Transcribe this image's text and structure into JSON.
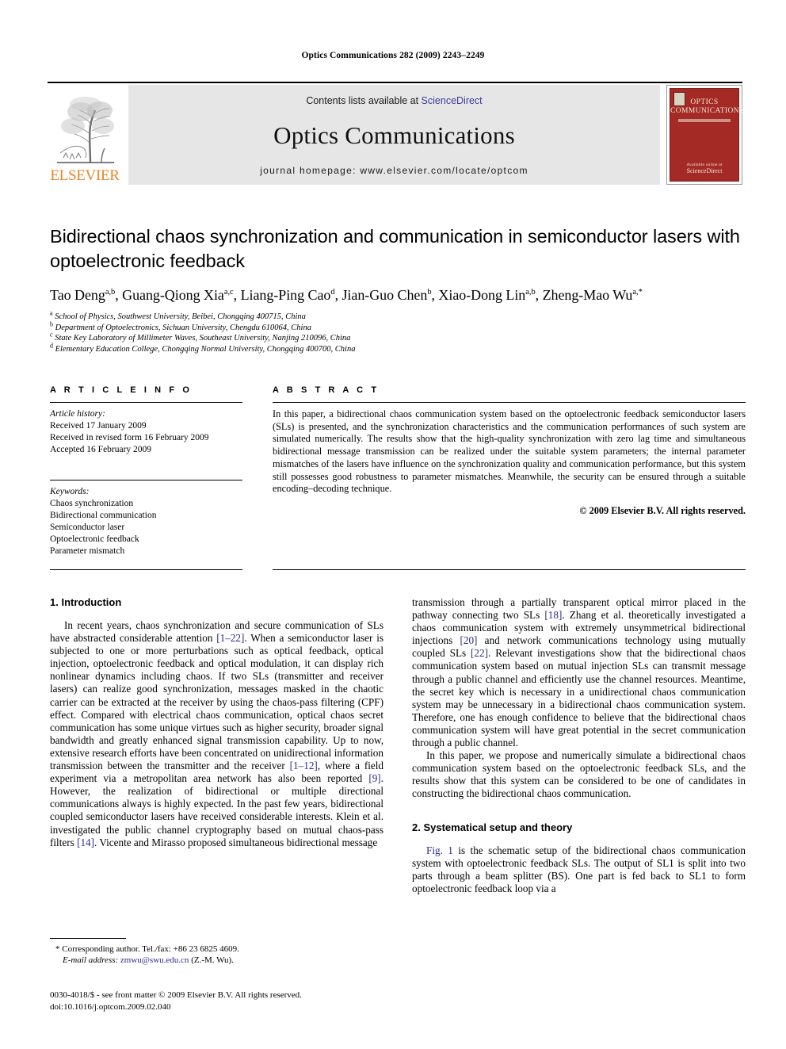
{
  "running_head": "Optics Communications 282 (2009) 2243–2249",
  "masthead": {
    "contents_prefix": "Contents lists available at ",
    "sciencedirect": "ScienceDirect",
    "journal_title": "Optics Communications",
    "homepage": "journal homepage: www.elsevier.com/locate/optcom",
    "publisher_wordmark": "ELSEVIER",
    "cover_title_line1": "OPTICS",
    "cover_title_line2": "COMMUNICATIONS",
    "cover_footer_line1": "Available online at",
    "cover_footer_line2": "ScienceDirect",
    "accent_orange": "#ec8424",
    "cover_red": "#a32a25",
    "link_blue": "#3b3b9e"
  },
  "title": "Bidirectional chaos synchronization and communication in semiconductor lasers with optoelectronic feedback",
  "authors": [
    {
      "name": "Tao Deng",
      "sup": "a,b",
      "sep": ", "
    },
    {
      "name": "Guang-Qiong Xia",
      "sup": "a,c",
      "sep": ", "
    },
    {
      "name": "Liang-Ping Cao",
      "sup": "d",
      "sep": ", "
    },
    {
      "name": "Jian-Guo Chen",
      "sup": "b",
      "sep": ", "
    },
    {
      "name": "Xiao-Dong Lin",
      "sup": "a,b",
      "sep": ", "
    },
    {
      "name": "Zheng-Mao Wu",
      "sup": "a,*",
      "sep": ""
    }
  ],
  "affiliations": [
    {
      "marker": "a",
      "text": "School of Physics, Southwest University, Beibei, Chongqing 400715, China"
    },
    {
      "marker": "b",
      "text": "Department of Optoelectronics, Sichuan University, Chengdu 610064, China"
    },
    {
      "marker": "c",
      "text": "State Key Laboratory of Millimeter Waves, Southeast University, Nanjing 210096, China"
    },
    {
      "marker": "d",
      "text": "Elementary Education College, Chongqing Normal University, Chongqing 400700, China"
    }
  ],
  "article_info": {
    "kicker": "A R T I C L E   I N F O",
    "history_label": "Article history:",
    "history": [
      "Received 17 January 2009",
      "Received in revised form 16 February 2009",
      "Accepted 16 February 2009"
    ],
    "keywords_label": "Keywords:",
    "keywords": [
      "Chaos synchronization",
      "Bidirectional communication",
      "Semiconductor laser",
      "Optoelectronic feedback",
      "Parameter mismatch"
    ]
  },
  "abstract": {
    "kicker": "A B S T R A C T",
    "text": "In this paper, a bidirectional chaos communication system based on the optoelectronic feedback semiconductor lasers (SLs) is presented, and the synchronization characteristics and the communication performances of such system are simulated numerically. The results show that the high-quality synchronization with zero lag time and simultaneous bidirectional message transmission can be realized under the suitable system parameters; the internal parameter mismatches of the lasers have influence on the synchronization quality and communication performance, but this system still possesses good robustness to parameter mismatches. Meanwhile, the security can be ensured through a suitable encoding–decoding technique.",
    "copyright": "© 2009 Elsevier B.V. All rights reserved."
  },
  "body": {
    "section1_heading": "1. Introduction",
    "section2_heading": "2. Systematical setup and theory",
    "left_p1_a": "In recent years, chaos synchronization and secure communication of SLs have abstracted considerable attention ",
    "left_p1_ref1": "[1–22]",
    "left_p1_b": ". When a semiconductor laser is subjected to one or more perturbations such as optical feedback, optical injection, optoelectronic feedback and optical modulation, it can display rich nonlinear dynamics including chaos. If two SLs (transmitter and receiver lasers) can realize good synchronization, messages masked in the chaotic carrier can be extracted at the receiver by using the chaos-pass filtering (CPF) effect. Compared with electrical chaos communication, optical chaos secret communication has some unique virtues such as higher security, broader signal bandwidth and greatly enhanced signal transmission capability. Up to now, extensive research efforts have been concentrated on unidirectional information transmission between the transmitter and the receiver ",
    "left_p1_ref2": "[1–12]",
    "left_p1_c": ", where a field experiment via a metropolitan area network has also been reported ",
    "left_p1_ref3": "[9]",
    "left_p1_d": ". However, the realization of bidirectional or multiple directional communications always is highly expected. In the past few years, bidirectional coupled semiconductor lasers have received considerable interests. Klein et al. investigated the public channel cryptography based on mutual chaos-pass filters ",
    "left_p1_ref4": "[14]",
    "left_p1_e": ". Vicente and Mirasso proposed simultaneous bidirectional message",
    "right_p1_a": "transmission through a partially transparent optical mirror placed in the pathway connecting two SLs ",
    "right_p1_ref1": "[18]",
    "right_p1_b": ". Zhang et al. theoretically investigated a chaos communication system with extremely unsymmetrical bidirectional injections ",
    "right_p1_ref2": "[20]",
    "right_p1_c": " and network communications technology using mutually coupled SLs ",
    "right_p1_ref3": "[22]",
    "right_p1_d": ". Relevant investigations show that the bidirectional chaos communication system based on mutual injection SLs can transmit message through a public channel and efficiently use the channel resources. Meantime, the secret key which is necessary in a unidirectional chaos communication system may be unnecessary in a bidirectional chaos communication system. Therefore, one has enough confidence to believe that the bidirectional chaos communication system will have great potential in the secret communication through a public channel.",
    "right_p2": "In this paper, we propose and numerically simulate a bidirectional chaos communication system based on the optoelectronic feedback SLs, and the results show that this system can be considered to be one of candidates in constructing the bidirectional chaos communication.",
    "right_p3_figref": "Fig. 1",
    "right_p3_rest": " is the schematic setup of the bidirectional chaos communication system with optoelectronic feedback SLs. The output of SL1 is split into two parts through a beam splitter (BS). One part is fed back to SL1 to form optoelectronic feedback loop via a"
  },
  "footnotes": {
    "corresponding": "Corresponding author. Tel./fax: +86 23 6825 4609.",
    "email_label": "E-mail address:",
    "email": "zmwu@swu.edu.cn",
    "email_suffix": " (Z.-M. Wu).",
    "imprint_line1": "0030-4018/$ - see front matter © 2009 Elsevier B.V. All rights reserved.",
    "imprint_line2": "doi:10.1016/j.optcom.2009.02.040"
  }
}
